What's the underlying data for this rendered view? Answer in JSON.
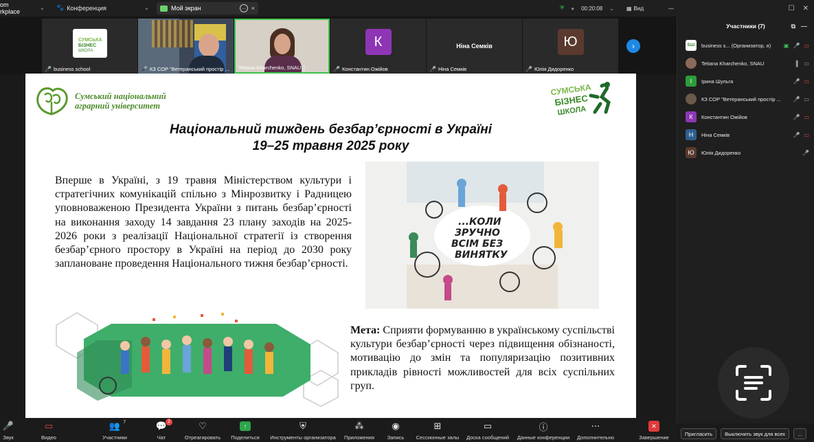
{
  "app": {
    "brand": "om\nrkplace"
  },
  "topbar": {
    "conference_label": "Конференция",
    "share_tab_label": "Мой экран",
    "timer": "00:20:08",
    "view_label": "Вид"
  },
  "panel": {
    "title": "Участники (7)",
    "participants": [
      {
        "name": "business s...",
        "role": "(Организатор, я)",
        "avatar_letter": "",
        "avatar_color": "#ffffff"
      },
      {
        "name": "Tetiana Kharchenko, SNAU",
        "role": "",
        "avatar_letter": "",
        "avatar_color": "#8a6a5a"
      },
      {
        "name": "Ірина Шульга",
        "role": "",
        "avatar_letter": "І",
        "avatar_color": "#2e9c3c"
      },
      {
        "name": "КЗ СОР \"Ветеранський простір ...",
        "role": "",
        "avatar_letter": "",
        "avatar_color": "#6a5a4a"
      },
      {
        "name": "Константин Ожійов",
        "role": "",
        "avatar_letter": "К",
        "avatar_color": "#8e35b5"
      },
      {
        "name": "Ніна Семків",
        "role": "",
        "avatar_letter": "Н",
        "avatar_color": "#2f5f8f"
      },
      {
        "name": "Юлія Дидоренко",
        "role": "",
        "avatar_letter": "Ю",
        "avatar_color": "#5a3a2e"
      }
    ],
    "invite_label": "Пригласить",
    "mute_all_label": "Выключить звук для всех"
  },
  "strip": {
    "tiles": [
      {
        "label": "business school"
      },
      {
        "label": "КЗ СОР \"Ветеранський простір ..."
      },
      {
        "label": "Tetiana Kharchenko, SNAU"
      },
      {
        "label": "Константин Ожійов",
        "avatar_letter": "К",
        "avatar_color": "#8e35b5"
      },
      {
        "label": "Ніна Семків",
        "center_name": "Ніна Семків"
      },
      {
        "label": "Юлія Дидоренко",
        "avatar_letter": "Ю",
        "avatar_color": "#5a3a2e"
      }
    ]
  },
  "slide": {
    "university": "Сумський національний\nаграрний університет",
    "school_logo_text": [
      "СУМСЬКА",
      "БІЗНЕС",
      "ШКОЛА"
    ],
    "title_line1": "Національний тиждень безбар’єрності в Україні",
    "title_line2": "19–25 травня 2025 року",
    "body": "Вперше в Україні, з  19 травня Міністерством культури і стратегічних комунікацій спільно з Мінрозвитку і Радницею уповноваженою Президента України з питань безбар’єрності на виконання заходу 14 завдання 23 плану заходів на 2025-2026 роки з реалізації Національної стратегії із створення безбар’єрного простору в Україні на період до 2030 року заплановане проведення Національного тижня безбар’єрності.",
    "art_text": [
      "...КОЛИ",
      "ЗРУЧНО",
      "ВСІМ БЕЗ",
      "ВИНЯТКУ"
    ],
    "goal_label": "Мета:",
    "goal_text": " Сприяти формуванню в українському суспільстві культури безбар’єрності через підвищення обізнаності, мотивацію до змін та популяризацію позитивних прикладів рівності можливостей для всіх суспільних груп."
  },
  "toolbar": {
    "items": [
      {
        "label": "Звук",
        "icon": "mic-off-icon"
      },
      {
        "label": "Видео",
        "icon": "video-off-icon"
      },
      {
        "label": "Участники",
        "icon": "participants-icon",
        "count": "7"
      },
      {
        "label": "Чат",
        "icon": "chat-icon",
        "badge": "2"
      },
      {
        "label": "Отреагировать",
        "icon": "reaction-icon"
      },
      {
        "label": "Поделиться",
        "icon": "share-icon"
      },
      {
        "label": "Инструменты организатора",
        "icon": "shield-icon"
      },
      {
        "label": "Приложения",
        "icon": "apps-icon"
      },
      {
        "label": "Запись",
        "icon": "record-icon"
      },
      {
        "label": "Сессионные залы",
        "icon": "rooms-icon"
      },
      {
        "label": "Доска сообщений",
        "icon": "whiteboard-icon"
      },
      {
        "label": "Данные конференции",
        "icon": "info-icon"
      },
      {
        "label": "Дополнительно",
        "icon": "more-icon"
      },
      {
        "label": "Завершение",
        "icon": "end-icon"
      }
    ]
  }
}
